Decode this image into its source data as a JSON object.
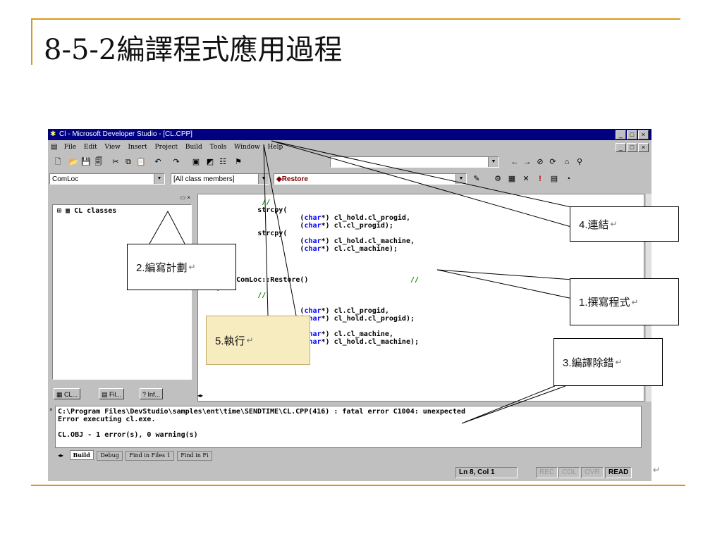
{
  "slide": {
    "title": "8-5-2編譯程式應用過程"
  },
  "window": {
    "title": "Cl - Microsoft Developer Studio - [CL.CPP]",
    "controls": [
      "_",
      "□",
      "×"
    ]
  },
  "menu": [
    "File",
    "Edit",
    "View",
    "Insert",
    "Project",
    "Build",
    "Tools",
    "Window",
    "Help"
  ],
  "combos": {
    "class": "ComLoc",
    "members": "[All class members]",
    "function": "◆Restore",
    "find": ""
  },
  "class_view": {
    "root": "CL classes",
    "tabs": [
      "CL...",
      "Fil...",
      "Inf..."
    ]
  },
  "editor": {
    "code": "           //\n          strcpy(\n                    (char*) cl_hold.cl_progid,\n                    (char*) cl.cl_progid);\n          strcpy(\n                    (char*) cl_hold.cl_machine,\n                    (char*) cl.cl_machine);\n\n\n\n     ComLoc::Restore()                        //\n{\n          //\n\n                    (char*) cl.cl_progid,\n                    (char*) cl_hold.cl_progid);\n\n                    (char*) cl.cl_machine,\n                    (char*) cl_hold.cl_machine);"
  },
  "output": {
    "lines": [
      "C:\\Program Files\\DevStudio\\samples\\ent\\time\\SENDTIME\\CL.CPP(416) : fatal error C1004: unexpected",
      "Error executing cl.exe.",
      "",
      "CL.OBJ - 1 error(s), 0 warning(s)"
    ],
    "tabs": [
      "Build",
      "Debug",
      "Find in Files 1",
      "Find in Fi"
    ]
  },
  "status": {
    "position": "Ln 8, Col 1",
    "rec": "REC",
    "col": "COL",
    "ovr": "OVR",
    "read": "READ"
  },
  "callouts": {
    "connect": "4.連結",
    "plan": "2.編寫計劃",
    "write": "1.撰寫程式",
    "run": "5.執行",
    "compile": "3.編譯除錯",
    "return_mark": "↵"
  }
}
